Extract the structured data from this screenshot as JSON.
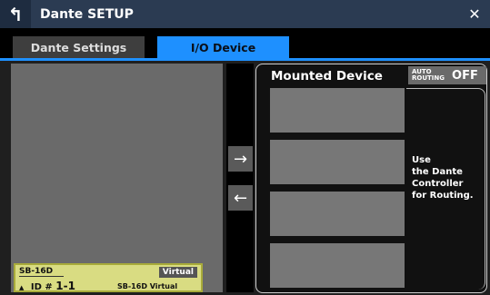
{
  "window": {
    "title": "Dante SETUP",
    "back_icon": "back-arrow-icon",
    "close_icon": "close-icon",
    "close_glyph": "✕"
  },
  "tabs": [
    {
      "label": "Dante Settings",
      "active": false
    },
    {
      "label": "I/O Device",
      "active": true
    }
  ],
  "device_card": {
    "name": "SB-16D",
    "badge": "Virtual",
    "id_prefix": "ID #",
    "id_value": "1-1",
    "subtitle": "SB-16D Virtual"
  },
  "transfer": {
    "right_glyph": "→",
    "left_glyph": "←"
  },
  "mounted": {
    "title": "Mounted Device",
    "auto_routing_label_line1": "AUTO",
    "auto_routing_label_line2": "ROUTING",
    "auto_routing_value": "OFF",
    "note_lines": [
      "Use",
      "the Dante",
      "Controller",
      "for Routing."
    ]
  },
  "colors": {
    "tab_active": "#1e90ff",
    "card_bg": "#d9dc82"
  }
}
